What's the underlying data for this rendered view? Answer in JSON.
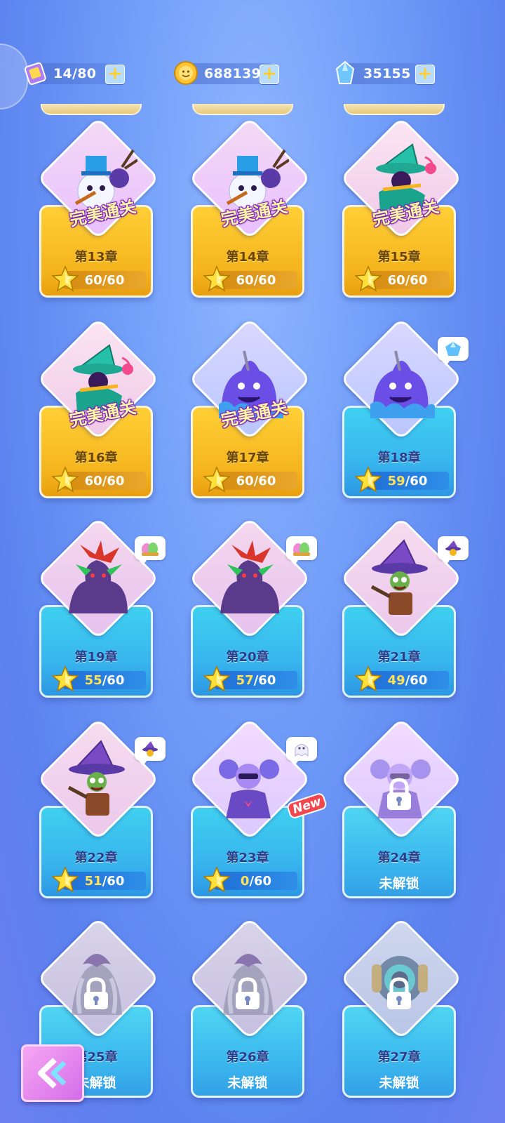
{
  "resources": {
    "energy": {
      "value": "14/80",
      "icon": "ticket-icon"
    },
    "coins": {
      "value": "688139",
      "icon": "coin-icon"
    },
    "gems": {
      "value": "35155",
      "icon": "crystal-icon"
    }
  },
  "chapters": [
    {
      "title": "第13章",
      "state": "perfect",
      "badge": "完美通关",
      "stars": "60",
      "total": "/60",
      "art": "snowman",
      "reward": ""
    },
    {
      "title": "第14章",
      "state": "perfect",
      "badge": "完美通关",
      "stars": "60",
      "total": "/60",
      "art": "snowman",
      "reward": ""
    },
    {
      "title": "第15章",
      "state": "perfect",
      "badge": "完美通关",
      "stars": "60",
      "total": "/60",
      "art": "witch-teal",
      "reward": ""
    },
    {
      "title": "第16章",
      "state": "perfect",
      "badge": "完美通关",
      "stars": "60",
      "total": "/60",
      "art": "witch-teal",
      "reward": ""
    },
    {
      "title": "第17章",
      "state": "perfect",
      "badge": "完美通关",
      "stars": "60",
      "total": "/60",
      "art": "slime",
      "reward": ""
    },
    {
      "title": "第18章",
      "state": "progress",
      "badge": "",
      "stars": "59",
      "total": "/60",
      "art": "slime",
      "reward": "crystal"
    },
    {
      "title": "第19章",
      "state": "progress",
      "badge": "",
      "stars": "55",
      "total": "/60",
      "art": "dragon",
      "reward": "egg"
    },
    {
      "title": "第20章",
      "state": "progress",
      "badge": "",
      "stars": "57",
      "total": "/60",
      "art": "dragon",
      "reward": "egg"
    },
    {
      "title": "第21章",
      "state": "progress",
      "badge": "",
      "stars": "49",
      "total": "/60",
      "art": "goblin-wizard",
      "reward": "wizard"
    },
    {
      "title": "第22章",
      "state": "progress",
      "badge": "",
      "stars": "51",
      "total": "/60",
      "art": "goblin-wizard",
      "reward": "wizard"
    },
    {
      "title": "第23章",
      "state": "progress",
      "badge": "",
      "stars": "0",
      "total": "/60",
      "art": "jester",
      "reward": "ghost",
      "new": "New"
    },
    {
      "title": "第24章",
      "state": "locked",
      "badge": "",
      "status": "未解锁",
      "art": "jester"
    },
    {
      "title": "第25章",
      "state": "locked",
      "badge": "",
      "status": "未解锁",
      "art": "wraith"
    },
    {
      "title": "第26章",
      "state": "locked",
      "badge": "",
      "status": "未解锁",
      "art": "wraith"
    },
    {
      "title": "第27章",
      "state": "locked",
      "badge": "",
      "status": "未解锁",
      "art": "golem"
    }
  ],
  "colors": {
    "gold": "#f5b51e",
    "blue": "#38b6ee",
    "perfect_text": "#fff7a0",
    "background": "#6f9cf8"
  },
  "back_button": {
    "icon": "chevron-left-icon"
  }
}
